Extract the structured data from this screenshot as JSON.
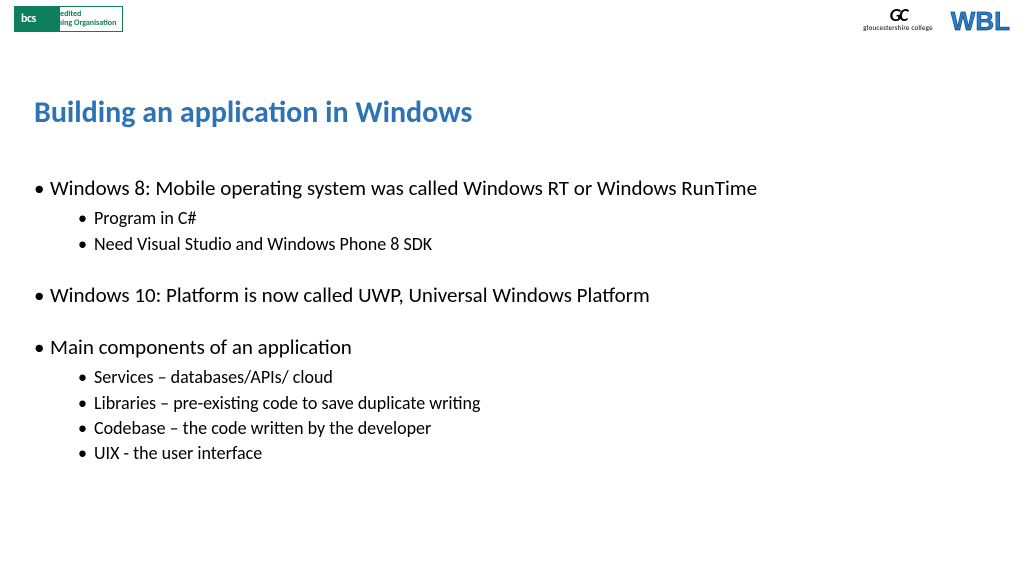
{
  "header": {
    "bcs_logo": "bcs",
    "bcs_line1": "Accredited",
    "bcs_line2": "Training Organisation",
    "gc_mark": "GC",
    "gc_sub": "gloucestershire college",
    "wbl": "WBL"
  },
  "title": "Building an application in Windows",
  "bullets": [
    {
      "text": "Windows 8: Mobile operating system was called Windows RT or Windows RunTime",
      "sub": [
        "Program in C#",
        "Need Visual Studio and Windows Phone 8 SDK"
      ]
    },
    {
      "text": "Windows 10: Platform is now called UWP, Universal Windows Platform",
      "sub": []
    },
    {
      "text": "Main components of an application",
      "sub": [
        "Services – databases/APIs/ cloud",
        "Libraries – pre-existing code to save duplicate writing",
        "Codebase – the code written by the developer",
        "UIX - the user interface"
      ]
    }
  ]
}
